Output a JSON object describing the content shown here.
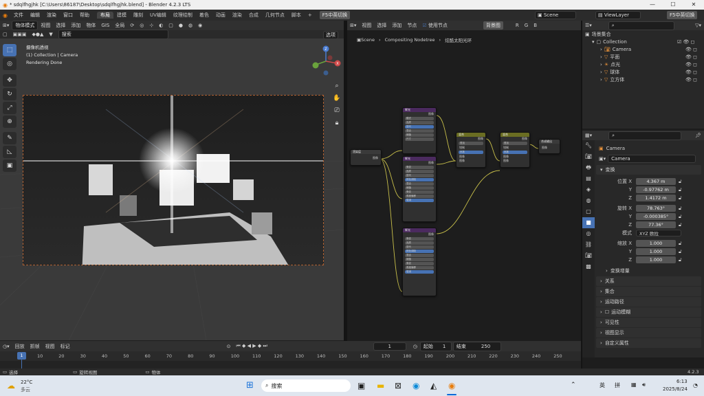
{
  "window": {
    "title": "* sdqlfhgjhk [C:\\Users\\86187\\Desktop\\sdqlfhgjhk.blend] - Blender 4.2.3 LTS"
  },
  "menu": [
    "文件",
    "编辑",
    "渲染",
    "窗口",
    "帮助"
  ],
  "workspaces": [
    "布局",
    "建模",
    "雕刻",
    "UV编辑",
    "纹理绘制",
    "着色",
    "动画",
    "渲染",
    "合成",
    "几何节点",
    "脚本"
  ],
  "ime_badge": "F5中英切换",
  "scene": {
    "label": "Scene",
    "viewlayer": "ViewLayer"
  },
  "viewport": {
    "mode": "物体模式",
    "menus": [
      "视图",
      "选择",
      "添加",
      "物体",
      "GIS"
    ],
    "transform": "全局",
    "search_placeholder": "搜索",
    "options": "选项",
    "overlay_title": "摄像机透视",
    "overlay_sub": "(1) Collection | Camera",
    "overlay_status": "Rendering Done"
  },
  "node_editor": {
    "menus": [
      "视图",
      "选择",
      "添加",
      "节点"
    ],
    "use_nodes": "使用节点",
    "backdrop": "背景图",
    "channels": [
      "R",
      "G",
      "B"
    ],
    "breadcrumb": [
      "Scene",
      "Compositing Nodetree",
      "炫酷太阳光环"
    ],
    "nodes": {
      "input": {
        "title": "渲染层",
        "socket": "图像"
      },
      "glare1": {
        "title": "辉光",
        "fields": [
          "模式",
          "品质",
          "迭代",
          "混合",
          "阈值",
          "尺寸"
        ],
        "out": "图像"
      },
      "glare2": {
        "title": "辉光",
        "fields": [
          "条纹",
          "品质",
          "迭代",
          "颜色调制",
          "混合",
          "阈值",
          "条纹",
          "角度偏移",
          "衰减"
        ],
        "out": "图像"
      },
      "glare3": {
        "title": "辉光",
        "fields": [
          "条纹",
          "品质",
          "迭代",
          "颜色调制",
          "混合",
          "阈值",
          "条纹",
          "角度偏移",
          "衰减"
        ],
        "out": "图像"
      },
      "mix1": {
        "title": "混合",
        "fields": [
          "叠加",
          "钳制",
          "系数",
          "图像",
          "图像"
        ],
        "out": "图像"
      },
      "mix2": {
        "title": "混合",
        "fields": [
          "叠加",
          "钳制",
          "系数",
          "图像",
          "图像"
        ],
        "out": "图像"
      },
      "output": {
        "title": "合成输出",
        "socket": "图像"
      }
    }
  },
  "outliner": {
    "title": "场景集合",
    "collection": "Collection",
    "items": [
      "Camera",
      "平面",
      "点光",
      "球体",
      "立方体"
    ]
  },
  "properties": {
    "object": "Camera",
    "datablock": "Camera",
    "transform_header": "变换",
    "location_label": "位置 X",
    "location": [
      "4.367 m",
      "-0.97762 m",
      "1.4172 m"
    ],
    "rotation_label": "旋转 X",
    "rotation": [
      "78.763°",
      "-0.000385°",
      "77.36°"
    ],
    "mode_label": "模式",
    "mode": "XYZ 欧拉",
    "scale_label": "缩放 X",
    "scale": [
      "1.000",
      "1.000",
      "1.000"
    ],
    "delta": "变换增量",
    "panels": [
      "关系",
      "集合",
      "运动路径",
      "运动模糊",
      "可见性",
      "视图显示",
      "自定义属性"
    ]
  },
  "timeline": {
    "menus": [
      "回放",
      "抓帧",
      "视图",
      "标记"
    ],
    "current_frame": "1",
    "start_label": "起始",
    "start": "1",
    "end_label": "结束",
    "end": "250",
    "ticks": [
      "1",
      "10",
      "20",
      "30",
      "40",
      "50",
      "60",
      "70",
      "80",
      "90",
      "100",
      "110",
      "120",
      "130",
      "140",
      "150",
      "160",
      "170",
      "180",
      "190",
      "200",
      "210",
      "220",
      "230",
      "240",
      "250"
    ]
  },
  "statusbar": {
    "select": "选择",
    "pan": "旋转视图",
    "object": "物体",
    "version": "4.2.3"
  },
  "taskbar": {
    "weather_temp": "22°C",
    "weather_desc": "多云",
    "search": "搜索",
    "lang1": "英",
    "lang2": "拼",
    "time": "6:13",
    "date": "2025/8/24"
  }
}
